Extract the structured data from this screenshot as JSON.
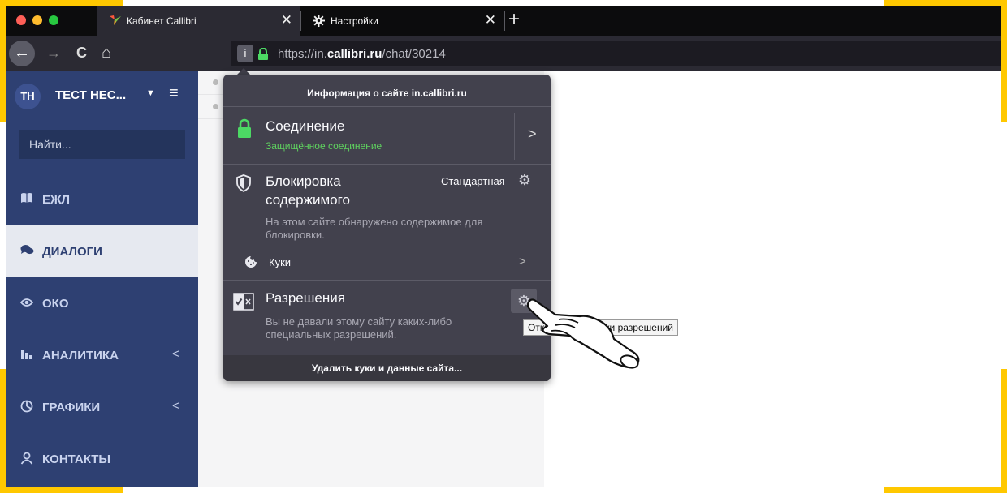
{
  "browser": {
    "tabs": [
      {
        "label": "Кабинет Callibri",
        "active": true
      },
      {
        "label": "Настройки",
        "active": false
      }
    ],
    "close_glyph": "✕",
    "new_tab_glyph": "+",
    "url": {
      "prefix": "https://in.",
      "domain": "callibri.ru",
      "path": "/chat/30214"
    },
    "info_glyph": "i",
    "nav": {
      "back": "←",
      "forward": "→",
      "reload": "C",
      "home": "⌂"
    }
  },
  "sidebar": {
    "avatar": "ТН",
    "name": "ТЕСТ НЕС...",
    "caret": "▼",
    "menu_glyph": "≡",
    "search_placeholder": "Найти...",
    "items": [
      {
        "label": "ЕЖЛ",
        "icon": "book-icon",
        "active": false,
        "has_chevron": false
      },
      {
        "label": "ДИАЛОГИ",
        "icon": "chat-icon",
        "active": true,
        "has_chevron": false
      },
      {
        "label": "ОКО",
        "icon": "eye-icon",
        "active": false,
        "has_chevron": false
      },
      {
        "label": "АНАЛИТИКА",
        "icon": "bar-chart-icon",
        "active": false,
        "has_chevron": true
      },
      {
        "label": "ГРАФИКИ",
        "icon": "pie-chart-icon",
        "active": false,
        "has_chevron": true
      },
      {
        "label": "КОНТАКТЫ",
        "icon": "contacts-icon",
        "active": false,
        "has_chevron": false
      }
    ],
    "chevron_glyph": "<"
  },
  "site_info": {
    "title": "Информация о сайте in.callibri.ru",
    "connection": {
      "label": "Соединение",
      "status": "Защищённое соединение",
      "chevron": ">"
    },
    "blocking": {
      "label_line1": "Блокировка",
      "label_line2": "содержимого",
      "mode": "Стандартная",
      "desc_line1": "На этом сайте обнаружено содержимое для",
      "desc_line2": "блокировки.",
      "cookies_label": "Куки",
      "cookies_chevron": ">"
    },
    "permissions": {
      "label": "Разрешения",
      "desc_line1": "Вы не давали этому сайту каких-либо",
      "desc_line2": "специальных разрешений."
    },
    "clear_button": "Удалить куки и данные сайта...",
    "gear_glyph": "⚙"
  },
  "tooltip": {
    "text": "Открыть настройки разрешений"
  },
  "colors": {
    "accent_yellow": "#FFC800",
    "sidebar_bg": "#2e4072",
    "secure_green": "#5fd35f",
    "popup_bg": "#42414d"
  }
}
